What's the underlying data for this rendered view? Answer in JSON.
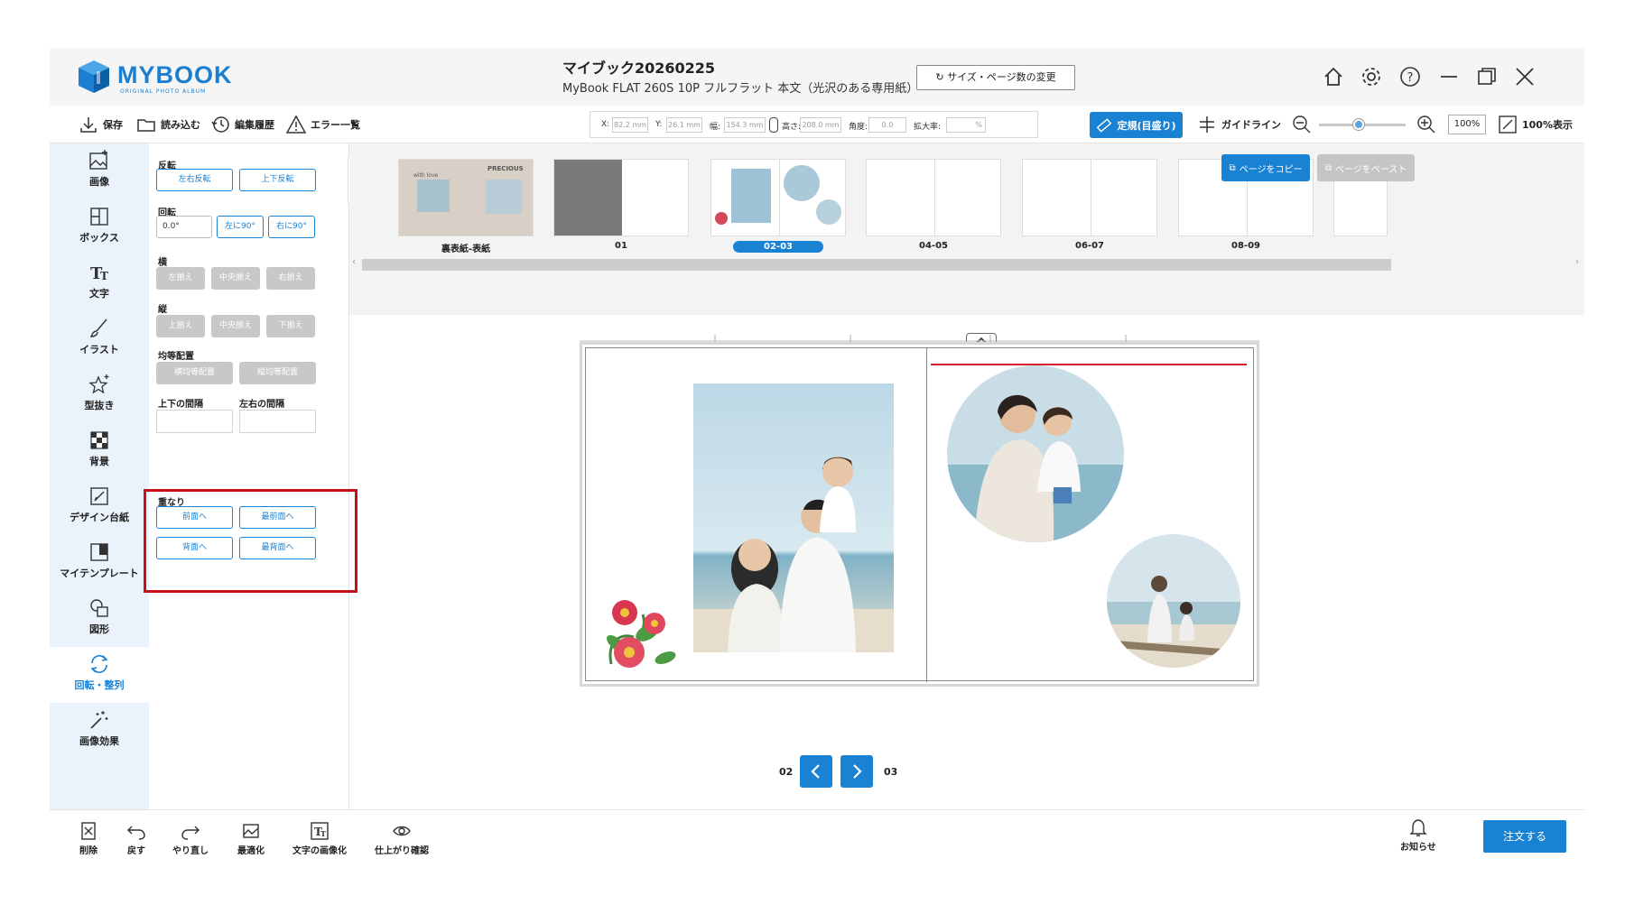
{
  "app": {
    "logo_text": "MYBOOK",
    "logo_sub": "ORIGINAL PHOTO ALBUM",
    "title": "マイブック20260225",
    "subtitle": "MyBook FLAT 260S 10P フルフラット 本文（光沢のある専用紙）",
    "size_change": "サイズ・ページ数の変更"
  },
  "toolbar": {
    "save": "保存",
    "load": "読み込む",
    "history": "編集履歴",
    "errors": "エラー一覧",
    "x_label": "X:",
    "x_val": "82.2 mm",
    "y_label": "Y:",
    "y_val": "26.1 mm",
    "w_label": "幅:",
    "w_val": "154.3 mm",
    "h_label": "高さ:",
    "h_val": "208.0 mm",
    "angle_label": "角度:",
    "angle_val": "0.0",
    "scale_label": "拡大率:",
    "scale_val": "%",
    "ruler": "定規(目盛り)",
    "guideline": "ガイドライン",
    "zoom": "100%",
    "fit": "100%表示"
  },
  "rail": [
    {
      "label": "画像",
      "icon": "image-add-icon"
    },
    {
      "label": "ボックス",
      "icon": "box-icon"
    },
    {
      "label": "文字",
      "icon": "text-icon"
    },
    {
      "label": "イラスト",
      "icon": "brush-icon"
    },
    {
      "label": "型抜き",
      "icon": "star-cut-icon"
    },
    {
      "label": "背景",
      "icon": "checker-icon"
    },
    {
      "label": "デザイン台紙",
      "icon": "design-icon"
    },
    {
      "label": "マイテンプレート",
      "icon": "template-icon"
    },
    {
      "label": "図形",
      "icon": "shape-icon"
    },
    {
      "label": "回転・整列",
      "icon": "rotate-icon"
    },
    {
      "label": "画像効果",
      "icon": "wand-icon"
    }
  ],
  "panel": {
    "flip": "反転",
    "flip_h": "左右反転",
    "flip_v": "上下反転",
    "rotate": "回転",
    "rotate_val": "0.0°",
    "rot_left": "左に90°",
    "rot_right": "右に90°",
    "horizontal": "横",
    "h_left": "左揃え",
    "h_center": "中央揃え",
    "h_right": "右揃え",
    "vertical": "縦",
    "v_top": "上揃え",
    "v_middle": "中央揃え",
    "v_bottom": "下揃え",
    "distribute": "均等配置",
    "dist_h": "横均等配置",
    "dist_v": "縦均等配置",
    "gap_v": "上下の間隔",
    "gap_h": "左右の間隔",
    "order": "重なり",
    "front": "前面へ",
    "frontmost": "最前面へ",
    "back": "背面へ",
    "backmost": "最背面へ"
  },
  "thumbs": {
    "copy": "ページをコピー",
    "paste": "ページをペースト",
    "items": [
      {
        "label": "裏表紙-表紙",
        "cover_text": "PRECIOUS",
        "cover_text2": "with love"
      },
      {
        "label": "01"
      },
      {
        "label": "02-03"
      },
      {
        "label": "04-05"
      },
      {
        "label": "06-07"
      },
      {
        "label": "08-09"
      }
    ]
  },
  "pager": {
    "left": "02",
    "right": "03"
  },
  "bottom": {
    "delete": "削除",
    "undo": "戻す",
    "redo": "やり直し",
    "optimize": "最適化",
    "text_image": "文字の画像化",
    "preview": "仕上がり確認",
    "notice": "お知らせ",
    "order": "注文する"
  },
  "colors": {
    "accent": "#1a82d3",
    "highlight": "#c8101a",
    "rail_bg": "#eaf3fb"
  }
}
